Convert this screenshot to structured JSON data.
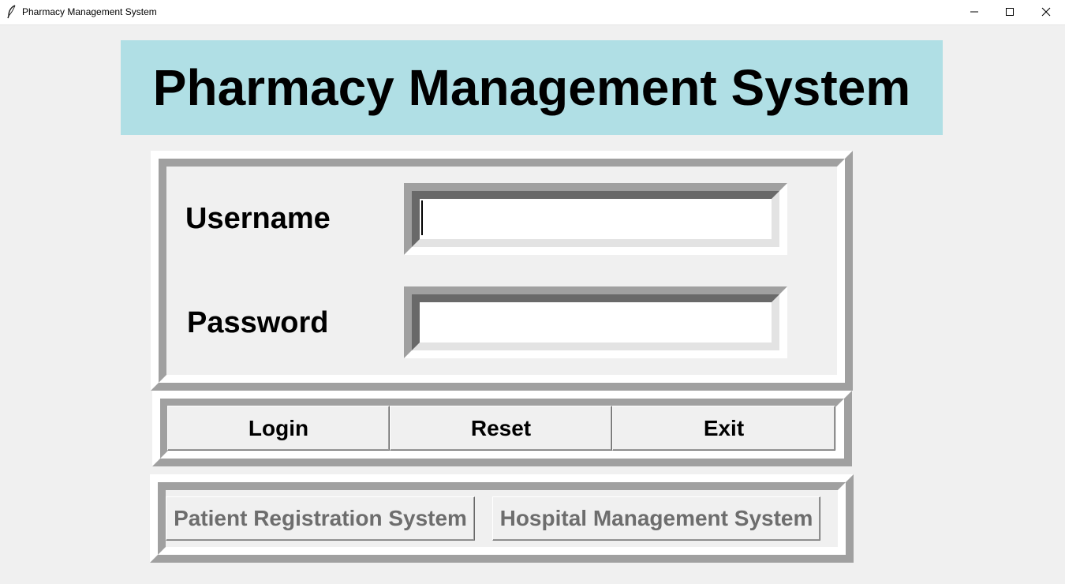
{
  "window": {
    "title": "Pharmacy Management System",
    "icon": "feather-icon",
    "controls": [
      "minimize-icon",
      "maximize-icon",
      "close-icon"
    ]
  },
  "header": {
    "title": "Pharmacy Management System",
    "background": "#b0dfe5"
  },
  "login_form": {
    "username_label": "Username",
    "username_value": "",
    "password_label": "Password",
    "password_value": ""
  },
  "actions": {
    "login": "Login",
    "reset": "Reset",
    "exit": "Exit"
  },
  "links": {
    "patient_registration": "Patient Registration System",
    "hospital_management": "Hospital Management System"
  }
}
